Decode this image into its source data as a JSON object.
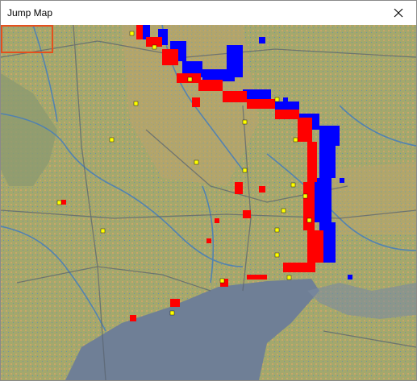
{
  "window": {
    "title": "Jump Map",
    "close_icon": "close-x-icon"
  },
  "map": {
    "colors": {
      "terrain": "#9aa86a",
      "terrain_warm": "#c8a86a",
      "sea": "#6f7f96",
      "river": "#4a7fb8",
      "road": "#5a6470",
      "front_red": "#ff0000",
      "front_blue": "#0000ff",
      "town_yellow": "#ffff00",
      "viewport_outline": "#e4501e"
    }
  }
}
